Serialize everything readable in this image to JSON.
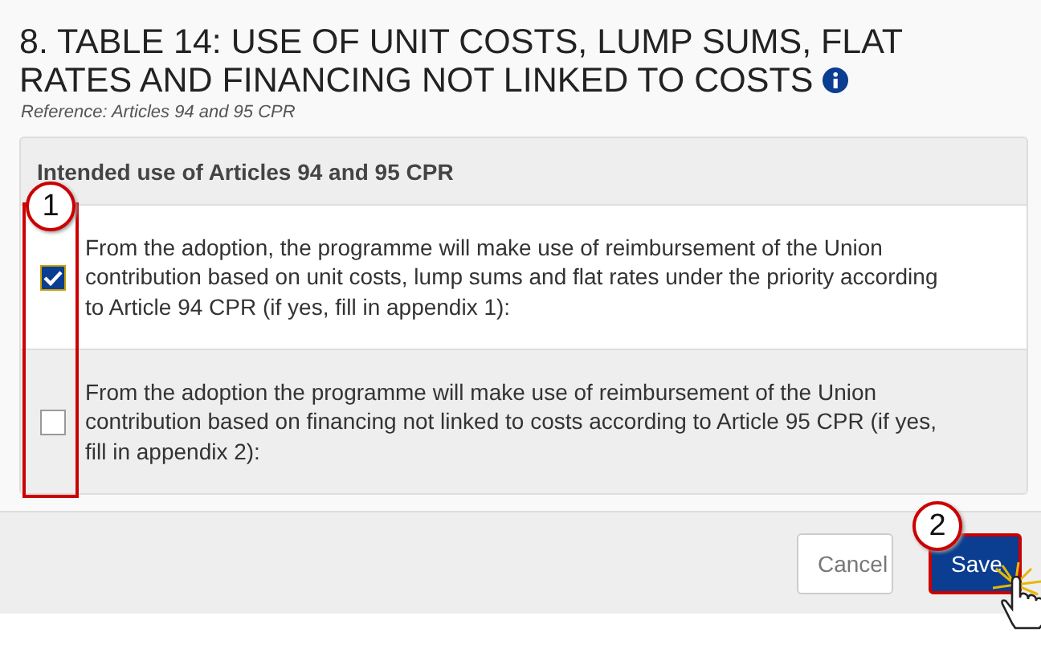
{
  "section": {
    "title": "8. TABLE 14: USE OF UNIT COSTS, LUMP SUMS, FLAT RATES AND FINANCING NOT LINKED TO COSTS",
    "reference": "Reference: Articles 94 and 95 CPR"
  },
  "table": {
    "header": "Intended use of Articles 94 and 95 CPR",
    "callout": "1",
    "rows": [
      {
        "text": "From the adoption, the programme will make use of reimbursement of the Union contribution based on unit costs, lump sums and flat rates under the priority according to Article 94 CPR (if yes, fill in appendix 1):",
        "checked": true
      },
      {
        "text": "From the adoption the programme will make use of reimbursement of the Union contribution based on financing not linked to costs according to Article 95 CPR (if yes, fill in appendix 2):",
        "checked": false
      }
    ]
  },
  "buttons": [
    {
      "label": "Cancel",
      "kind": "secondary"
    },
    {
      "label": "Save",
      "kind": "primary",
      "callout": "2"
    }
  ]
}
